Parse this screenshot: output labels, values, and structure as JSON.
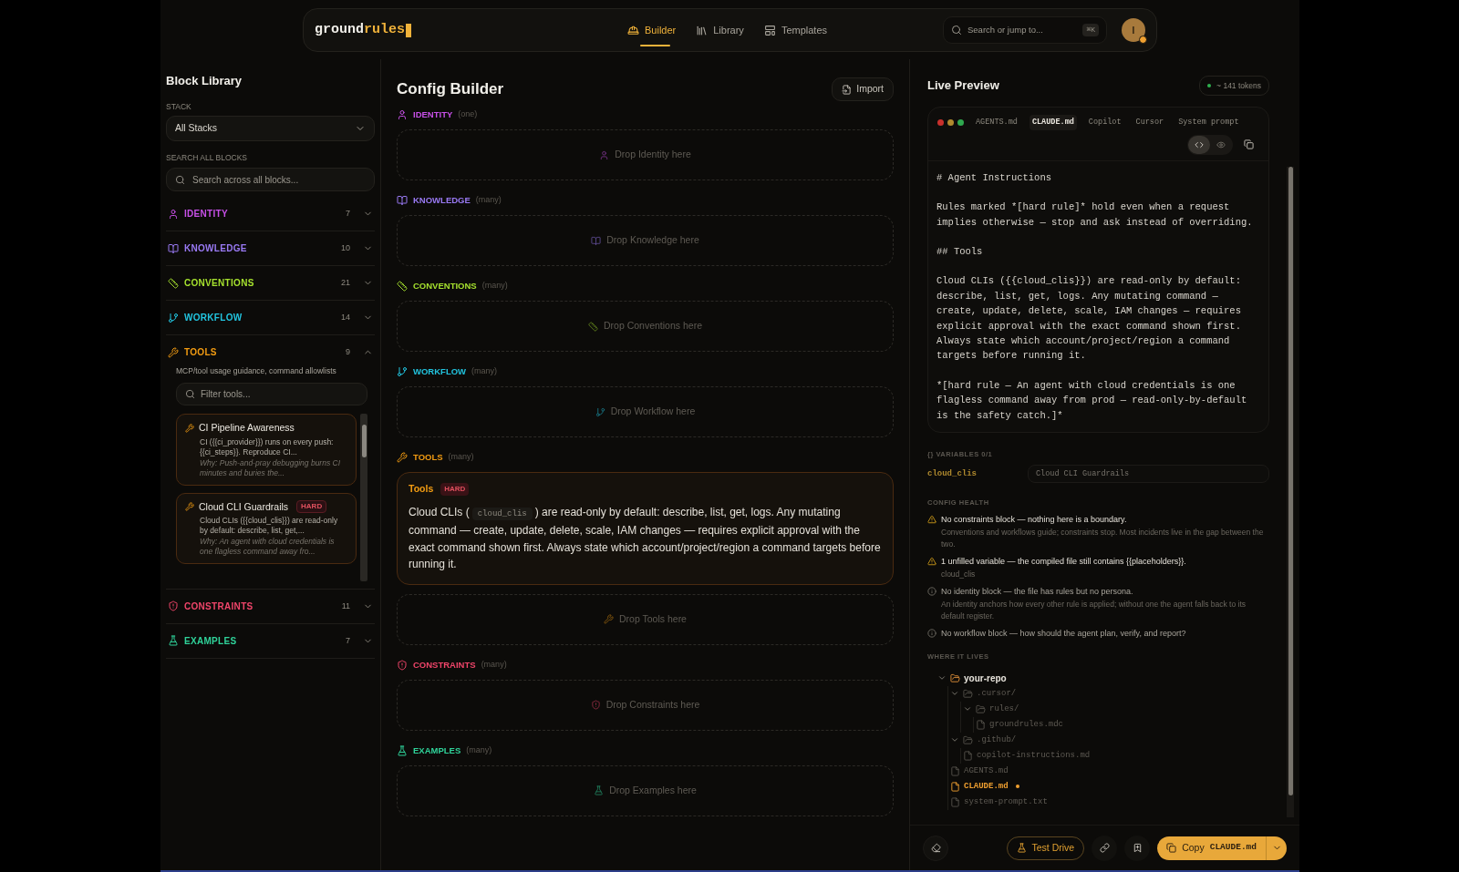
{
  "topbar": {
    "logo": {
      "text": "ground",
      "accent": "rules"
    },
    "nav": [
      {
        "label": "Builder",
        "kind": "builder",
        "selected": true
      },
      {
        "label": "Library",
        "kind": "library",
        "selected": false
      },
      {
        "label": "Templates",
        "kind": "templates",
        "selected": false
      }
    ],
    "search": {
      "placeholder": "Search or jump to...",
      "shortcut": "⌘K"
    },
    "avatar": {
      "initial": "I"
    }
  },
  "sidebar": {
    "title": "Block Library",
    "stack_label": "STACK",
    "stack_value": "All Stacks",
    "search_label": "SEARCH ALL BLOCKS",
    "search_placeholder": "Search across all blocks...",
    "categories": [
      {
        "label": "IDENTITY",
        "kind": "identity",
        "color": "#c850e8",
        "count": "7",
        "expanded": false
      },
      {
        "label": "KNOWLEDGE",
        "kind": "knowledge",
        "color": "#9a7af5",
        "count": "10",
        "expanded": false
      },
      {
        "label": "CONVENTIONS",
        "kind": "conventions",
        "color": "#a6e22e",
        "count": "21",
        "expanded": false
      },
      {
        "label": "WORKFLOW",
        "kind": "workflow",
        "color": "#22c5e0",
        "count": "14",
        "expanded": false
      },
      {
        "label": "TOOLS",
        "kind": "tools",
        "color": "#f39c12",
        "count": "9",
        "expanded": true,
        "description": "MCP/tool usage guidance, command allowlists",
        "filter_placeholder": "Filter tools...",
        "items": [
          {
            "title": "CI Pipeline Awareness",
            "hard": false,
            "body": "CI ({{ci_provider}}) runs on every push: {{ci_steps}}. Reproduce CI...",
            "why": "Why: Push-and-pray debugging burns CI minutes and buries the..."
          },
          {
            "title": "Cloud CLI Guardrails",
            "hard": true,
            "badge": "HARD",
            "body": "Cloud CLIs ({{cloud_clis}}) are read-only by default: describe, list, get,...",
            "why": "Why: An agent with cloud credentials is one flagless command away fro..."
          }
        ]
      },
      {
        "label": "CONSTRAINTS",
        "kind": "constraints",
        "color": "#f0456a",
        "count": "11",
        "expanded": false
      },
      {
        "label": "EXAMPLES",
        "kind": "examples",
        "color": "#2fd39a",
        "count": "7",
        "expanded": false
      }
    ]
  },
  "builder": {
    "title": "Config Builder",
    "import_label": "Import",
    "sections": [
      {
        "label": "IDENTITY",
        "kind": "identity",
        "color": "#c850e8",
        "cardinality": "(one)",
        "drop": "Drop Identity here"
      },
      {
        "label": "KNOWLEDGE",
        "kind": "knowledge",
        "color": "#9a7af5",
        "cardinality": "(many)",
        "drop": "Drop Knowledge here"
      },
      {
        "label": "CONVENTIONS",
        "kind": "conventions",
        "color": "#a6e22e",
        "cardinality": "(many)",
        "drop": "Drop Conventions here"
      },
      {
        "label": "WORKFLOW",
        "kind": "workflow",
        "color": "#22c5e0",
        "cardinality": "(many)",
        "drop": "Drop Workflow here"
      },
      {
        "label": "TOOLS",
        "kind": "tools",
        "color": "#f39c12",
        "cardinality": "(many)",
        "drop": "Drop Tools here",
        "blocks": [
          {
            "title": "Tools",
            "badge": "HARD",
            "before": "Cloud CLIs (",
            "code": "cloud_clis",
            "after": ") are read-only by default: describe, list, get, logs. Any mutating command — create, update, delete, scale, IAM changes — requires explicit approval with the exact command shown first. Always state which account/project/region a command targets before running it."
          }
        ]
      },
      {
        "label": "CONSTRAINTS",
        "kind": "constraints",
        "color": "#f0456a",
        "cardinality": "(many)",
        "drop": "Drop Constraints here"
      },
      {
        "label": "EXAMPLES",
        "kind": "examples",
        "color": "#2fd39a",
        "cardinality": "(many)",
        "drop": "Drop Examples here"
      }
    ]
  },
  "preview": {
    "title": "Live Preview",
    "tokens": "~ 141 tokens",
    "tabs": [
      {
        "label": "AGENTS.md",
        "selected": false
      },
      {
        "label": "CLAUDE.md",
        "selected": true
      },
      {
        "label": "Copilot",
        "selected": false
      },
      {
        "label": "Cursor",
        "selected": false
      },
      {
        "label": "System prompt",
        "selected": false
      }
    ],
    "view": [
      {
        "kind": "code",
        "selected": true
      },
      {
        "kind": "eye",
        "selected": false
      }
    ],
    "content": [
      "# Agent Instructions",
      "Rules marked *[hard rule]* hold even when a request implies otherwise — stop and ask instead of overriding.",
      "## Tools",
      "Cloud CLIs ({{cloud_clis}}) are read-only by default: describe, list, get, logs. Any mutating command — create, update, delete, scale, IAM changes — requires explicit approval with the exact command shown first. Always state which account/project/region a command targets before running it.",
      "*[hard rule — An agent with cloud credentials is one flagless command away from prod — read-only-by-default is the safety catch.]*"
    ],
    "variables": {
      "label": "{} VARIABLES 0/1",
      "items": [
        {
          "name": "cloud_clis",
          "placeholder": "Cloud CLI Guardrails"
        }
      ]
    },
    "health": {
      "label": "CONFIG HEALTH",
      "items": [
        {
          "kind": "warning",
          "title": "No constraints block — nothing here is a boundary.",
          "detail": "Conventions and workflows guide; constraints stop. Most incidents live in the gap between the two."
        },
        {
          "kind": "warning",
          "title": "1 unfilled variable — the compiled file still contains {{placeholders}}.",
          "detail": "cloud_clis"
        },
        {
          "kind": "info",
          "title": "No identity block — the file has rules but no persona.",
          "detail": "An identity anchors how every other rule is applied; without one the agent falls back to its default register."
        },
        {
          "kind": "info",
          "title": "No workflow block — how should the agent plan, verify, and report?"
        }
      ]
    },
    "tree_label": "WHERE IT LIVES",
    "tree": [
      {
        "name": "your-repo",
        "kind": "folder",
        "expanded": true,
        "selected": false,
        "children": [
          {
            "name": ".cursor/",
            "kind": "folder",
            "expanded": true,
            "selected": false,
            "children": [
              {
                "name": "rules/",
                "kind": "folder",
                "expanded": true,
                "selected": false,
                "children": [
                  {
                    "name": "groundrules.mdc",
                    "kind": "file",
                    "selected": false
                  }
                ]
              }
            ]
          },
          {
            "name": ".github/",
            "kind": "folder",
            "expanded": true,
            "selected": false,
            "children": [
              {
                "name": "copilot-instructions.md",
                "kind": "file",
                "selected": false
              }
            ]
          },
          {
            "name": "AGENTS.md",
            "kind": "file",
            "selected": false
          },
          {
            "name": "CLAUDE.md",
            "kind": "file",
            "selected": true
          },
          {
            "name": "system-prompt.txt",
            "kind": "file",
            "selected": false
          }
        ]
      }
    ],
    "footer": {
      "test_drive": "Test Drive",
      "copy_label": "Copy",
      "copy_file": "CLAUDE.md"
    }
  }
}
